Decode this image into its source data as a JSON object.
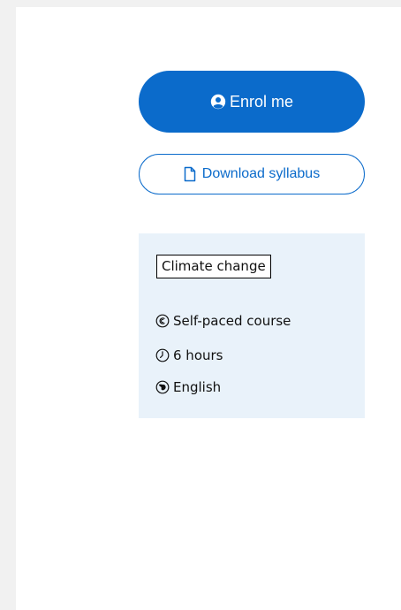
{
  "actions": {
    "enrol_label": "Enrol me",
    "syllabus_label": "Download syllabus"
  },
  "course_info": {
    "topic_tag": "Climate change",
    "format": "Self-paced course",
    "duration": "6 hours",
    "language": "English"
  },
  "icons": {
    "enrol": "user-circle-icon",
    "syllabus": "document-icon",
    "format": "copyright-circle-icon",
    "duration": "clock-icon",
    "language": "globe-icon"
  },
  "colors": {
    "primary": "#0b6bcb",
    "info_background": "#e9f2fa",
    "page_background": "#f1f1f1",
    "panel_background": "#ffffff"
  }
}
